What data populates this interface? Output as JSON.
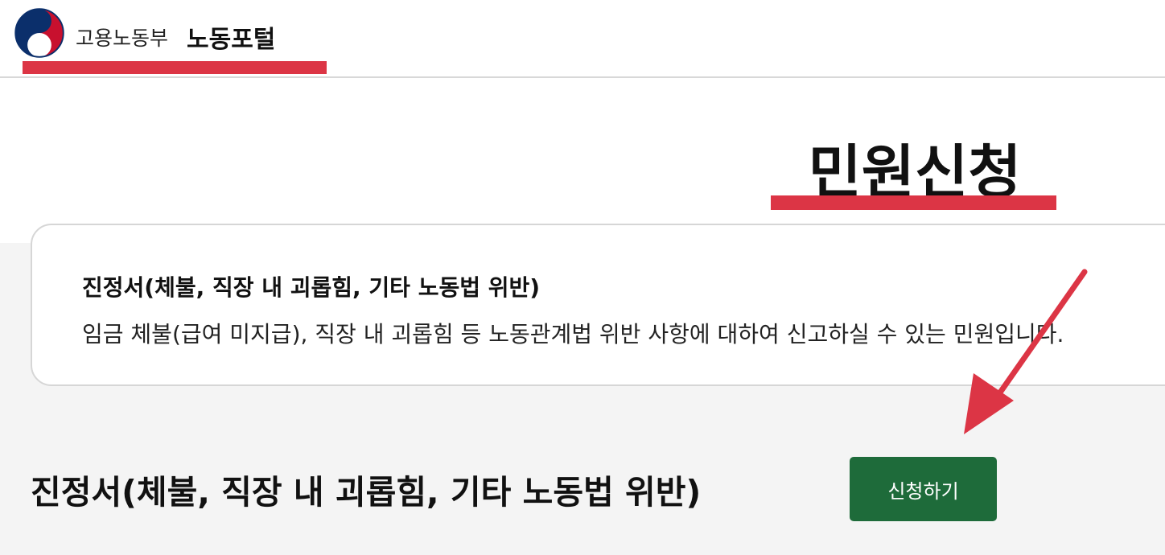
{
  "header": {
    "ministry_name": "고용노동부",
    "portal_name": "노동포털"
  },
  "page": {
    "title": "민원신청"
  },
  "card": {
    "title": "진정서(체불, 직장 내 괴롭힘, 기타 노동법 위반)",
    "description": "임금 체불(급여 미지급), 직장 내 괴롭힘 등 노동관계법 위반 사항에 대하여 신고하실 수 있는 민원입니다."
  },
  "section": {
    "title": "진정서(체불, 직장 내 괴롭힘, 기타 노동법 위반)",
    "apply_label": "신청하기"
  },
  "icons": {
    "logo": "government-emblem-icon",
    "annotation": "red-arrow-icon"
  },
  "colors": {
    "accent_red": "#dc3545",
    "button_green": "#1e6b3a",
    "emblem_blue": "#0b2f6b",
    "emblem_red": "#c8102e"
  }
}
